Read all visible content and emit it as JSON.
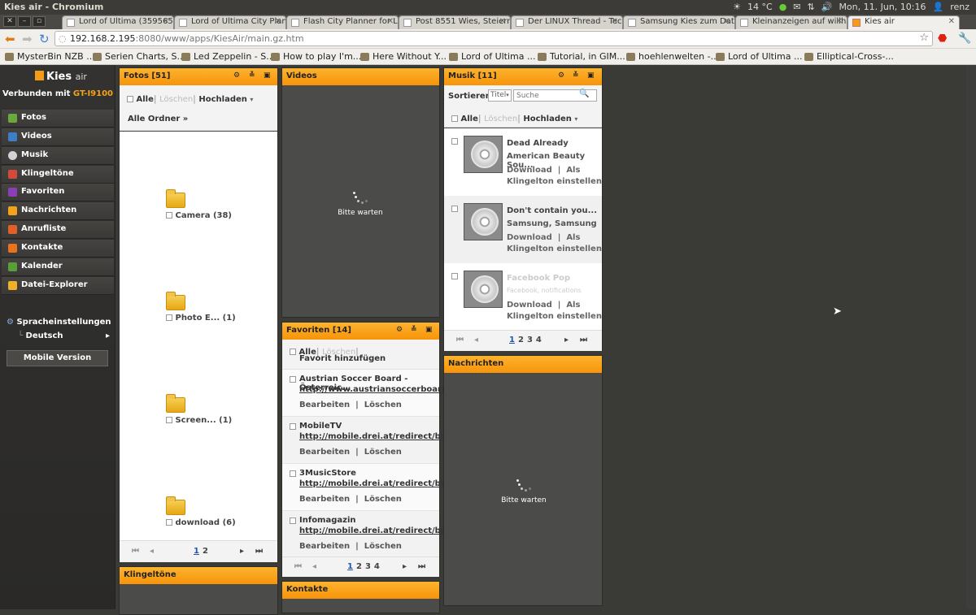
{
  "os_bar": {
    "window_title": "Kies air - Chromium",
    "weather": "14 °C",
    "datetime": "Mon, 11. Jun, 10:16",
    "user": "renz"
  },
  "browser": {
    "tabs": [
      {
        "label": "Lord of Ultima (359565)"
      },
      {
        "label": "Lord of Ultima City Planner"
      },
      {
        "label": "Flash City Planner for Lor"
      },
      {
        "label": "Post 8551 Wies, Steiermar"
      },
      {
        "label": "Der LINUX Thread - Techn"
      },
      {
        "label": "Samsung Kies zum Datenab"
      },
      {
        "label": "Kleinanzeigen auf willhab"
      },
      {
        "label": "Kies air"
      }
    ],
    "url_host": "192.168.2.195",
    "url_rest": ":8080/www/apps/KiesAir/main.gz.htm",
    "bookmarks": [
      {
        "label": "MysterBin NZB ..."
      },
      {
        "label": "Serien Charts, S..."
      },
      {
        "label": "Led Zeppelin - S..."
      },
      {
        "label": "How to play I'm..."
      },
      {
        "label": "Here Without Y..."
      },
      {
        "label": "Lord of Ultima ..."
      },
      {
        "label": "Tutorial, in GIM..."
      },
      {
        "label": "hoehlenwelten -..."
      },
      {
        "label": "Lord of Ultima ..."
      },
      {
        "label": "Elliptical-Cross-..."
      }
    ]
  },
  "app": {
    "logo_kies": "Kies",
    "logo_air": "air",
    "connected_prefix": "Verbunden mit ",
    "device": "GT-I9100",
    "menu": [
      {
        "label": "Fotos",
        "color": "#6aaa3c"
      },
      {
        "label": "Videos",
        "color": "#3d7fc4"
      },
      {
        "label": "Musik",
        "color": "#cfd3d8"
      },
      {
        "label": "Klingeltöne",
        "color": "#d44a3a"
      },
      {
        "label": "Favoriten",
        "color": "#8b3fb5"
      },
      {
        "label": "Nachrichten",
        "color": "#f2a31b"
      },
      {
        "label": "Anrufliste",
        "color": "#e25f2a"
      },
      {
        "label": "Kontakte",
        "color": "#e8731c"
      },
      {
        "label": "Kalender",
        "color": "#5a9e3a"
      },
      {
        "label": "Datei-Explorer",
        "color": "#f0b12a"
      }
    ],
    "language_label": "Spracheinstellungen",
    "language_value": "Deutsch",
    "mobile_version": "Mobile Version"
  },
  "fotos": {
    "title": "Fotos [51]",
    "all": "Alle",
    "delete": "Löschen",
    "upload": "Hochladen",
    "all_folders": "Alle Ordner »",
    "folders": [
      {
        "name": "Camera",
        "count": "(38)"
      },
      {
        "name": "Photo E...",
        "count": "(1)"
      },
      {
        "name": "Screen...",
        "count": "(1)"
      },
      {
        "name": "download",
        "count": "(6)"
      }
    ],
    "pages": [
      "1",
      "2"
    ]
  },
  "videos": {
    "title": "Videos",
    "loading": "Bitte warten"
  },
  "musik": {
    "title": "Musik [11]",
    "sort_label": "Sortieren",
    "sort_value": "Titel",
    "search_placeholder": "Suche",
    "all": "Alle",
    "delete": "Löschen",
    "upload": "Hochladen",
    "tracks": [
      {
        "title": "Dead Already",
        "artist": "American Beauty Sou...",
        "download": "Download",
        "as": "Als",
        "ringtone": "Klingelton einstellen",
        "muted": false
      },
      {
        "title": "Don't contain you...",
        "artist": "Samsung, Samsung",
        "download": "Download",
        "as": "Als",
        "ringtone": "Klingelton einstellen",
        "muted": false
      },
      {
        "title": "Facebook Pop",
        "artist": "Facebook, notifications",
        "download": "Download",
        "as": "Als",
        "ringtone": "Klingelton einstellen",
        "muted": true
      }
    ],
    "pages": [
      "1",
      "2",
      "3",
      "4"
    ]
  },
  "favoriten": {
    "title": "Favoriten [14]",
    "all": "Alle",
    "delete": "Löschen",
    "add": "Favorit hinzufügen",
    "items": [
      {
        "name": "Austrian Soccer Board - Österreic...",
        "url": "http://www.austriansoccerboard....",
        "edit": "Bearbeiten",
        "remove": "Löschen"
      },
      {
        "name": "MobileTV",
        "url": "http://mobile.drei.at/redirect/br...",
        "edit": "Bearbeiten",
        "remove": "Löschen"
      },
      {
        "name": "3MusicStore",
        "url": "http://mobile.drei.at/redirect/br...",
        "edit": "Bearbeiten",
        "remove": "Löschen"
      },
      {
        "name": "Infomagazin",
        "url": "http://mobile.drei.at/redirect/br...",
        "edit": "Bearbeiten",
        "remove": "Löschen"
      }
    ],
    "pages": [
      "1",
      "2",
      "3",
      "4"
    ]
  },
  "nachrichten": {
    "title": "Nachrichten",
    "loading": "Bitte warten"
  },
  "klingeltoene": {
    "title": "Klingeltöne"
  },
  "kontakte": {
    "title": "Kontakte"
  },
  "pager_glyphs": {
    "first": "⏮",
    "prev": "◂",
    "next": "▸",
    "last": "⏭"
  }
}
